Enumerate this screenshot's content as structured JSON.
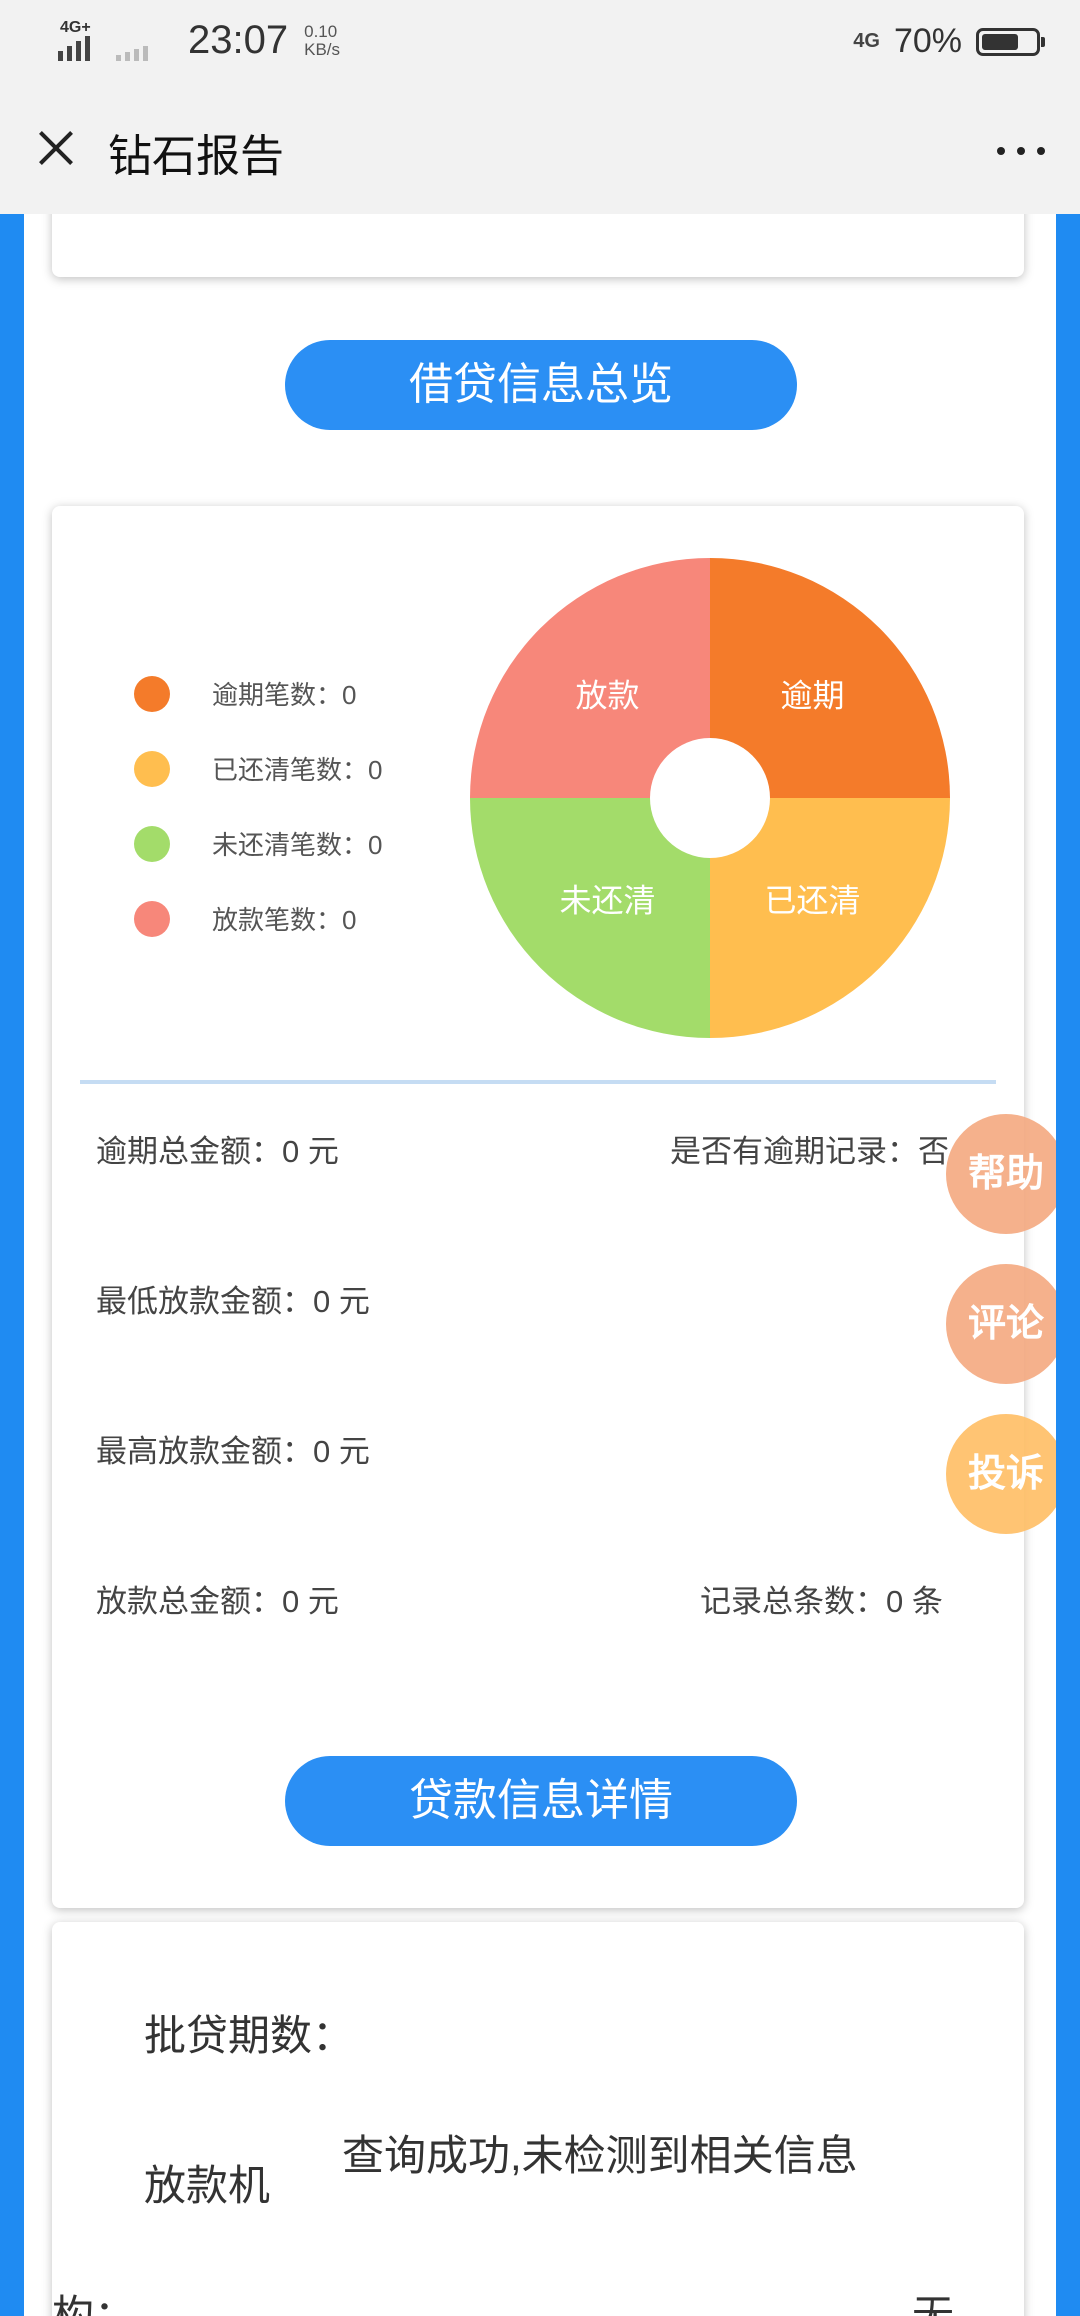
{
  "status_bar": {
    "network1": "4G+",
    "network2": "4G",
    "time": "23:07",
    "speed_value": "0.10",
    "speed_unit": "KB/s",
    "battery": "70%",
    "battery_level": 0.7
  },
  "title_bar": {
    "title": "钻石报告"
  },
  "sections": {
    "overview_label": "借贷信息总览",
    "detail_label": "贷款信息详情"
  },
  "legend": [
    {
      "text": "逾期笔数：0",
      "color": "#f47b2a"
    },
    {
      "text": "已还清笔数：0",
      "color": "#ffbe4f"
    },
    {
      "text": "未还清笔数：0",
      "color": "#a3dc6a"
    },
    {
      "text": "放款笔数：0",
      "color": "#f7877a"
    }
  ],
  "chart_data": {
    "type": "pie",
    "categories": [
      "逾期",
      "已还清",
      "未还清",
      "放款"
    ],
    "values": [
      1,
      1,
      1,
      1
    ],
    "colors": [
      "#f47b2a",
      "#ffbe4f",
      "#a3dc6a",
      "#f7877a"
    ]
  },
  "stats": {
    "overdue_total": "逾期总金额：0  元",
    "has_overdue": "是否有逾期记录：否",
    "min_loan": "最低放款金额：0  元",
    "max_loan": "最高放款金额：0  元",
    "loan_total": "放款总金额：0  元",
    "record_count": "记录总条数：0  条"
  },
  "fabs": {
    "help": "帮助",
    "comment": "评论",
    "complain": "投诉"
  },
  "detail": {
    "periods_label": "批贷期数：",
    "institution_label": "放款机",
    "institution_label_cont": "构：",
    "message": "查询成功,未检测到相关信息",
    "none_value": "无"
  }
}
